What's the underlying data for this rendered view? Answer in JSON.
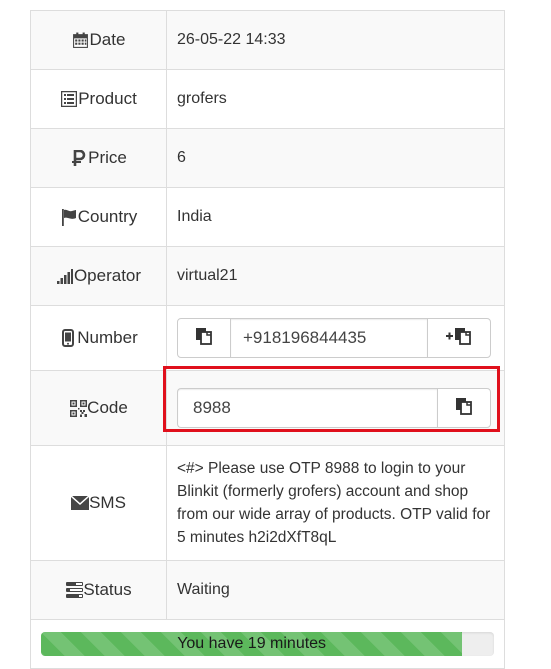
{
  "rows": {
    "date": {
      "label": "Date",
      "icon": "calendar-icon",
      "value": "26-05-22 14:33"
    },
    "product": {
      "label": "Product",
      "icon": "list-icon",
      "value": "grofers"
    },
    "price": {
      "label": "Price",
      "icon": "ruble-icon",
      "value": "6"
    },
    "country": {
      "label": "Country",
      "icon": "flag-icon",
      "value": "India"
    },
    "operator": {
      "label": "Operator",
      "icon": "signal-icon",
      "value": "virtual21"
    },
    "number": {
      "label": "Number",
      "icon": "mobile-icon",
      "value": "+918196844435",
      "left_button_icon": "copy-icon",
      "right_button_icon": "plus-copy-icon"
    },
    "code": {
      "label": "Code",
      "icon": "qrcode-icon",
      "value": "8988",
      "button_icon": "copy-icon"
    },
    "sms": {
      "label": "SMS",
      "icon": "envelope-icon",
      "value": "<#> Please use OTP 8988 to login to your Blinkit (formerly grofers) account and shop from our wide array of products. OTP valid for 5 minutes h2i2dXfT8qL"
    },
    "status": {
      "label": "Status",
      "icon": "tasks-icon",
      "value": "Waiting"
    }
  },
  "progress": {
    "text": "You have 19 minutes",
    "fraction": 0.93,
    "color": "#5cb85c"
  },
  "colors": {
    "highlight": "#e0101c",
    "border": "#dddddd",
    "stripe": "#f9f9f9"
  }
}
